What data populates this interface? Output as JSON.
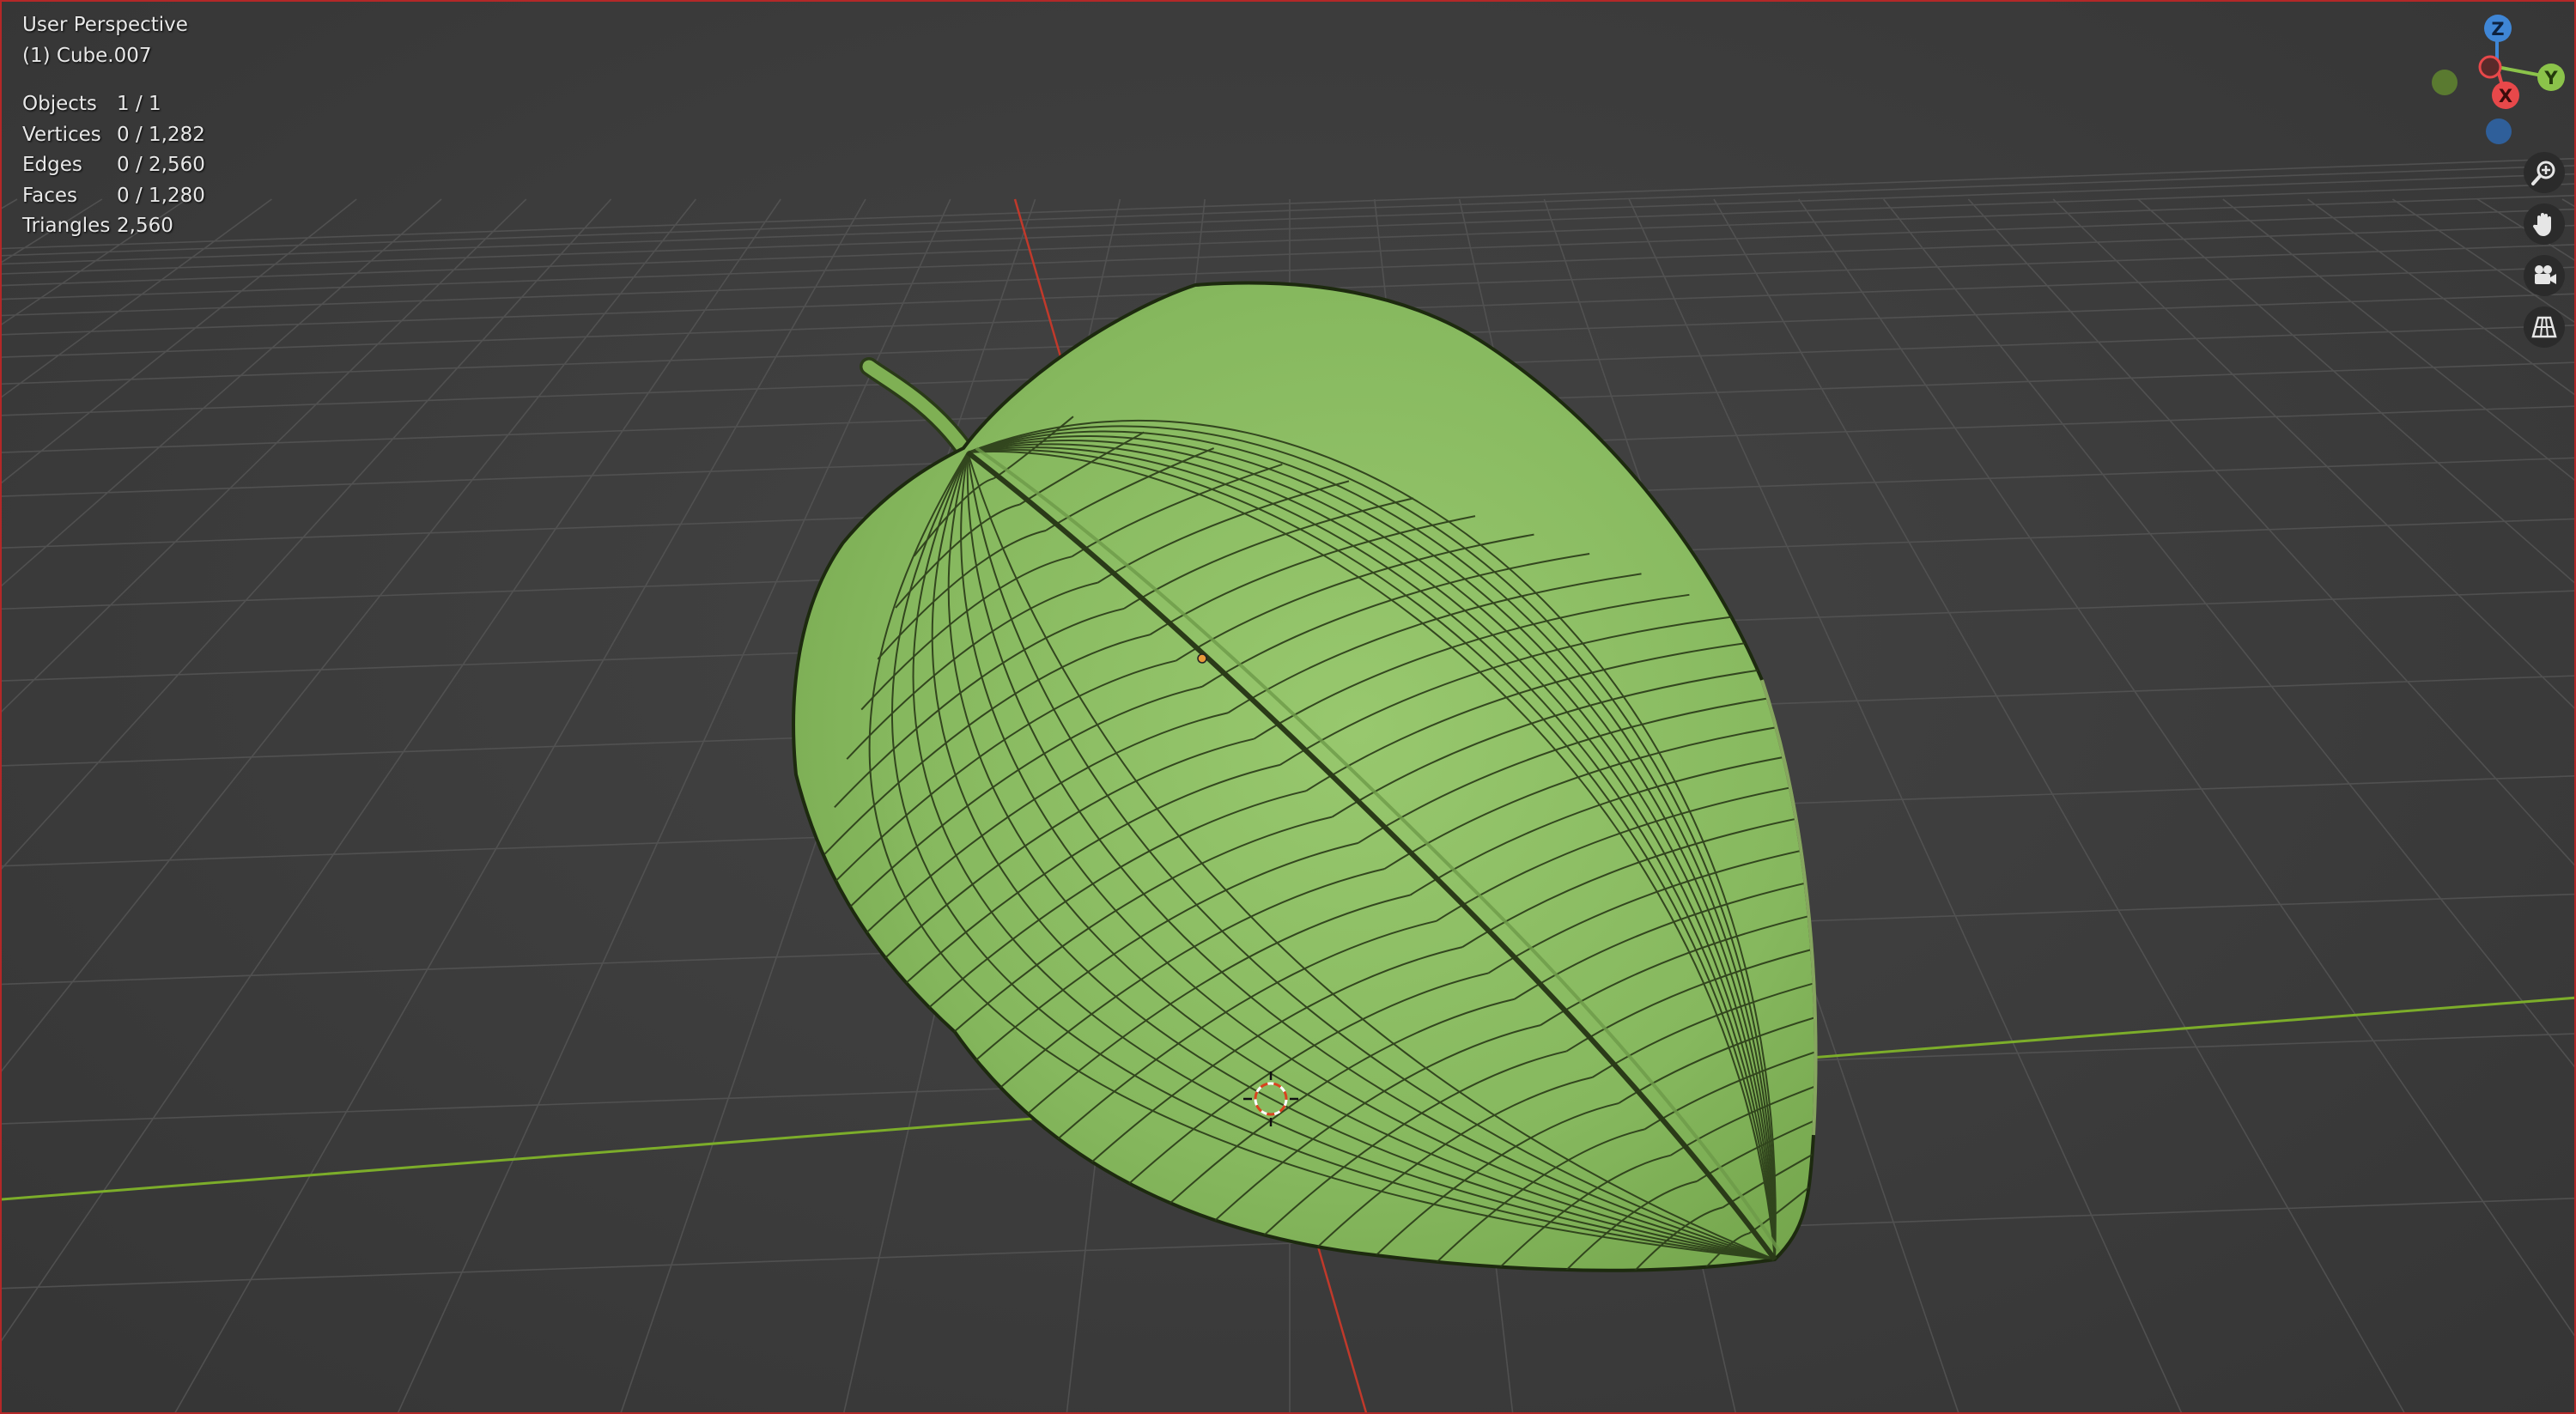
{
  "viewport": {
    "title": "User Perspective",
    "object_line": "(1) Cube.007"
  },
  "stats": [
    {
      "label": "Objects",
      "value": "1 / 1"
    },
    {
      "label": "Vertices",
      "value": "0 / 1,282"
    },
    {
      "label": "Edges",
      "value": "0 / 2,560"
    },
    {
      "label": "Faces",
      "value": "0 / 1,280"
    },
    {
      "label": "Triangles",
      "value": "2,560"
    }
  ],
  "gizmo": {
    "x_label": "X",
    "y_label": "Y",
    "z_label": "Z"
  },
  "nav_tools": [
    {
      "icon": "zoom-icon"
    },
    {
      "icon": "hand-icon"
    },
    {
      "icon": "camera-icon"
    },
    {
      "icon": "grid-icon"
    }
  ],
  "colors": {
    "background": "#3d3d3d",
    "grid": "#555555",
    "x_axis": "#c0392b",
    "y_axis": "#7cad2a",
    "leaf": "#8abd63",
    "wire": "#2a3a18",
    "gizmo_x": "#e8484a",
    "gizmo_y": "#8bc34a",
    "gizmo_z": "#3f86d6"
  }
}
